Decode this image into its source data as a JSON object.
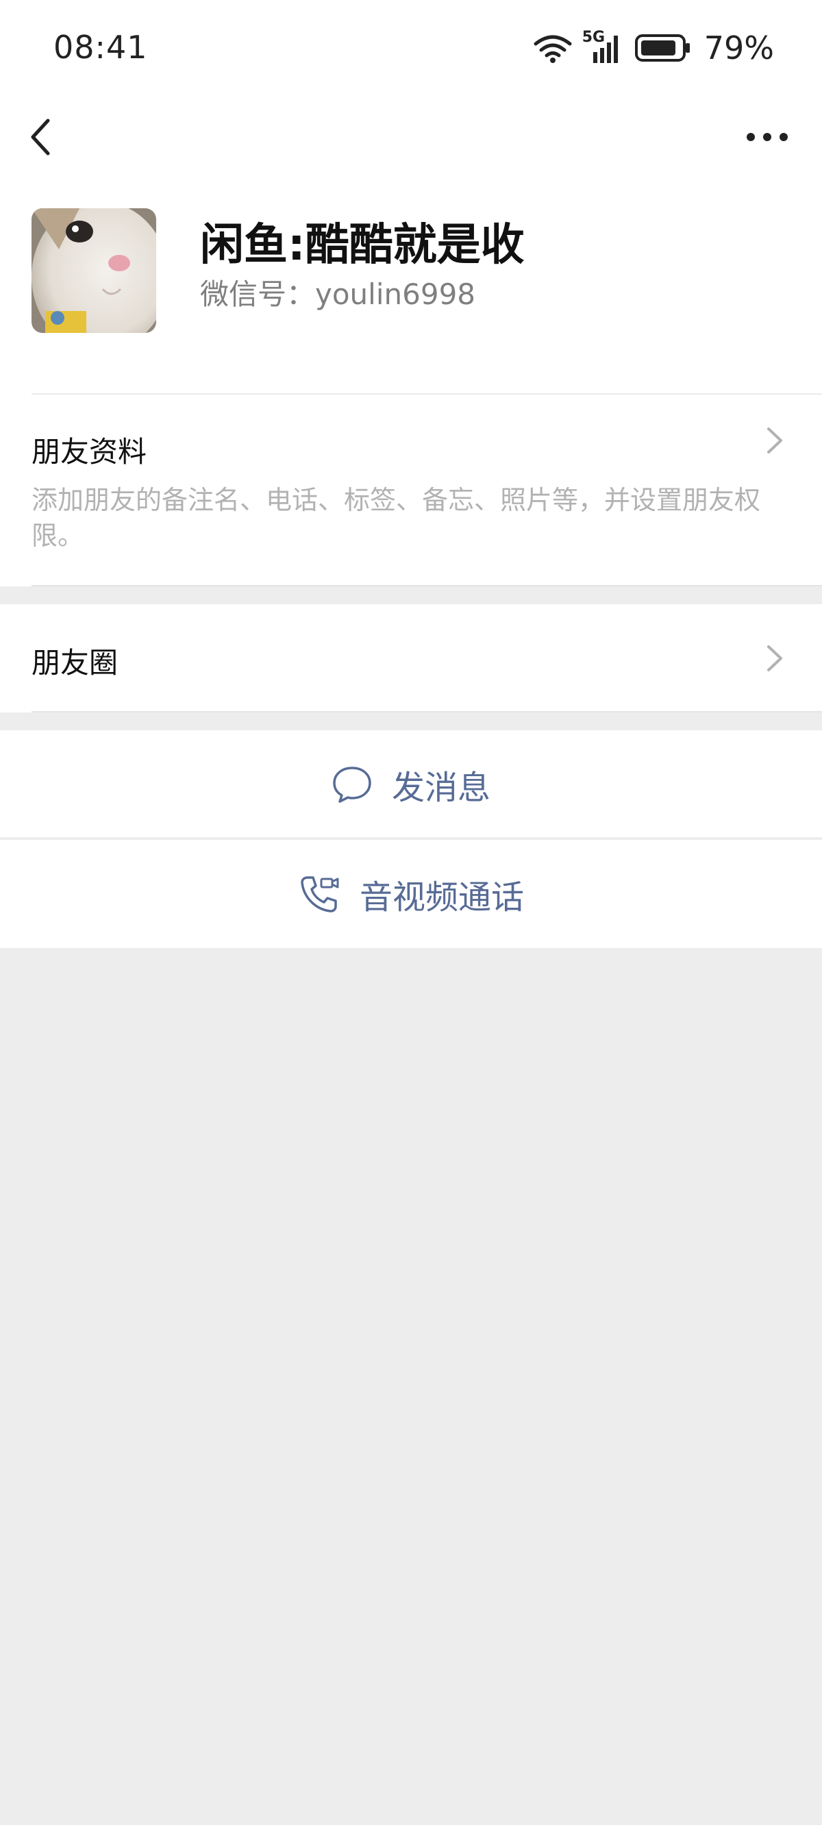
{
  "status_bar": {
    "time": "08:41",
    "network": "5G",
    "battery": "79%",
    "icons": [
      "wifi-icon",
      "signal-icon",
      "battery-icon"
    ]
  },
  "nav": {
    "back_icon": "back-chevron-icon",
    "more_icon": "more-dots-icon"
  },
  "profile": {
    "nickname": "闲鱼:酷酷就是收",
    "wechat_id": "微信号：youlin6998",
    "avatar": "cat-avatar"
  },
  "cells": {
    "friend_info": {
      "title": "朋友资料",
      "description": "添加朋友的备注名、电话、标签、备忘、照片等，并设置朋友权限。"
    },
    "moments": {
      "title": "朋友圈"
    }
  },
  "actions": {
    "message": {
      "label": "发消息",
      "icon": "chat-bubble-icon"
    },
    "call": {
      "label": "音视频通话",
      "icon": "phone-video-icon"
    }
  },
  "colors": {
    "link": "#576b95",
    "background": "#ededed",
    "card": "#ffffff",
    "secondary_text": "#b2b2b2"
  }
}
